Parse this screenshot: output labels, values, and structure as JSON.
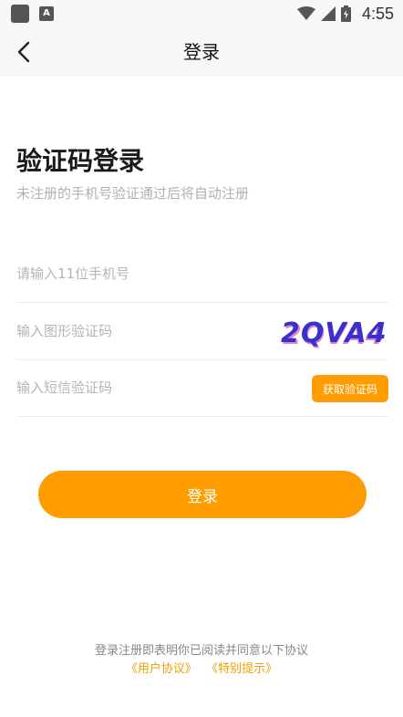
{
  "status_bar": {
    "time": "4:55",
    "notification_icon": "notification-icon",
    "app_icon": "a-icon",
    "app_icon_letter": "A",
    "wifi_icon": "wifi-icon",
    "signal_icon": "signal-icon",
    "battery_icon": "battery-icon"
  },
  "header": {
    "title": "登录",
    "back_icon": "back-arrow-icon"
  },
  "main": {
    "heading": "验证码登录",
    "subtitle": "未注册的手机号验证通过后将自动注册",
    "phone_placeholder": "请输入11位手机号",
    "captcha_placeholder": "输入图形验证码",
    "captcha_text": "2QVA4",
    "sms_placeholder": "输入短信验证码",
    "sms_button": "获取验证码",
    "login_button": "登录"
  },
  "footer": {
    "agreement_text": "登录注册即表明你已阅读并同意以下协议",
    "user_agreement": "《用户协议》",
    "special_notice": "《特别提示》"
  },
  "colors": {
    "accent": "#ff9c00",
    "link": "#f0a000",
    "captcha_main": "#3a2fd0",
    "captcha_secondary": "#d0208a"
  }
}
